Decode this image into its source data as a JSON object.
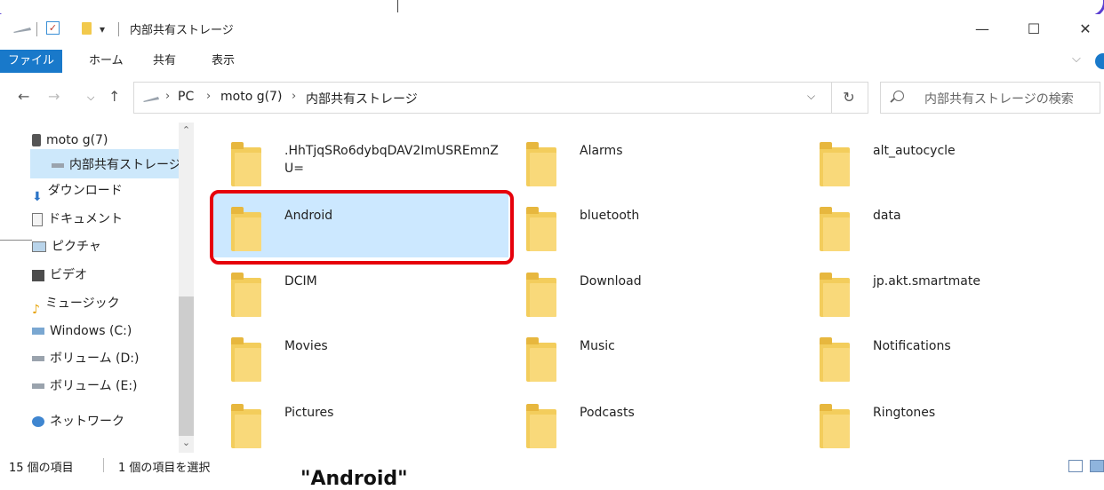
{
  "window": {
    "title": "内部共有ストレージ",
    "buttons": {
      "minimize": "—",
      "maximize": "☐",
      "close": "✕"
    }
  },
  "ribbon": {
    "tabs": [
      "ファイル",
      "ホーム",
      "共有",
      "表示"
    ]
  },
  "address": {
    "crumbs": [
      "PC",
      "moto g(7)",
      "内部共有ストレージ"
    ],
    "search_placeholder": "内部共有ストレージの検索"
  },
  "nav": {
    "items": [
      {
        "label": "moto g(7)",
        "icon": "phone-icon"
      },
      {
        "label": "内部共有ストレージ",
        "icon": "drive-icon",
        "selected": true
      },
      {
        "label": "ダウンロード",
        "icon": "download-icon"
      },
      {
        "label": "ドキュメント",
        "icon": "document-icon"
      },
      {
        "label": "ピクチャ",
        "icon": "pictures-icon"
      },
      {
        "label": "ビデオ",
        "icon": "video-icon"
      },
      {
        "label": "ミュージック",
        "icon": "music-icon"
      },
      {
        "label": "Windows (C:)",
        "icon": "windows-drive-icon"
      },
      {
        "label": "ボリューム (D:)",
        "icon": "volume-icon"
      },
      {
        "label": "ボリューム (E:)",
        "icon": "volume-icon"
      },
      {
        "label": "ネットワーク",
        "icon": "network-icon"
      }
    ]
  },
  "folders": [
    ".HhTjqSRo6dybqDAV2ImUSREmnZU=",
    "Alarms",
    "alt_autocycle",
    "Android",
    "bluetooth",
    "data",
    "DCIM",
    "Download",
    "jp.akt.smartmate",
    "Movies",
    "Music",
    "Notifications",
    "Pictures",
    "Podcasts",
    "Ringtones"
  ],
  "selected_folder": "Android",
  "status": {
    "count": "15 個の項目",
    "selection": "1 個の項目を選択"
  },
  "caption": "\"Android\""
}
